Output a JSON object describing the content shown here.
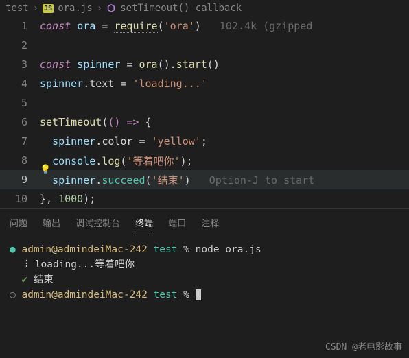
{
  "breadcrumb": {
    "folder": "test",
    "file": "ora.js",
    "symbol": "setTimeout() callback"
  },
  "hints": {
    "size": "102.4k (gzipped",
    "shortcut": "Option-J to start"
  },
  "code": {
    "l1": {
      "const": "const",
      "name": "ora",
      "eq": " = ",
      "req": "require",
      "lp": "(",
      "str": "'ora'",
      "rp": ")"
    },
    "l3": {
      "const": "const",
      "name": "spinner",
      "eq": " = ",
      "fn": "ora",
      "call": "().",
      "start": "start",
      "end": "()"
    },
    "l4": {
      "obj": "spinner",
      "dot": ".",
      "prop": "text",
      "eq": " = ",
      "str": "'loading...'"
    },
    "l6": {
      "fn": "setTimeout",
      "lp": "(",
      "arrow": "() => ",
      "brace": "{"
    },
    "l7": {
      "obj": "spinner",
      "dot": ".",
      "prop": "color",
      "eq": " = ",
      "str": "'yellow'",
      "semi": ";"
    },
    "l8": {
      "obj": "console",
      "dot": ".",
      "fn": "log",
      "lp": "(",
      "str": "'等着吧你'",
      "rp": ")",
      "semi": ";"
    },
    "l9": {
      "obj": "spinner",
      "dot": ".",
      "fn": "succeed",
      "lp": "(",
      "str": "'结束'",
      "rp": ")"
    },
    "l10": {
      "brace": "}",
      "comma": ", ",
      "num": "1000",
      "rp": ")",
      "semi": ";"
    }
  },
  "lineNumbers": [
    "1",
    "2",
    "3",
    "4",
    "5",
    "6",
    "7",
    "8",
    "9",
    "10"
  ],
  "panel": {
    "tabs": [
      "问题",
      "输出",
      "调试控制台",
      "终端",
      "端口",
      "注释"
    ],
    "activeIndex": 3
  },
  "terminal": {
    "prompt1_user": "admin@admindeiMac-242",
    "prompt1_dir": "test",
    "prompt1_sep": " % ",
    "cmd1": "node ora.js",
    "loading_prefix": "⠸ ",
    "loading": "loading...等着吧你",
    "done_mark": "✔ ",
    "done": "结束",
    "prompt2_user": "admin@admindeiMac-242",
    "prompt2_dir": "test",
    "prompt2_sep": " % "
  },
  "watermark": "CSDN @老电影故事"
}
